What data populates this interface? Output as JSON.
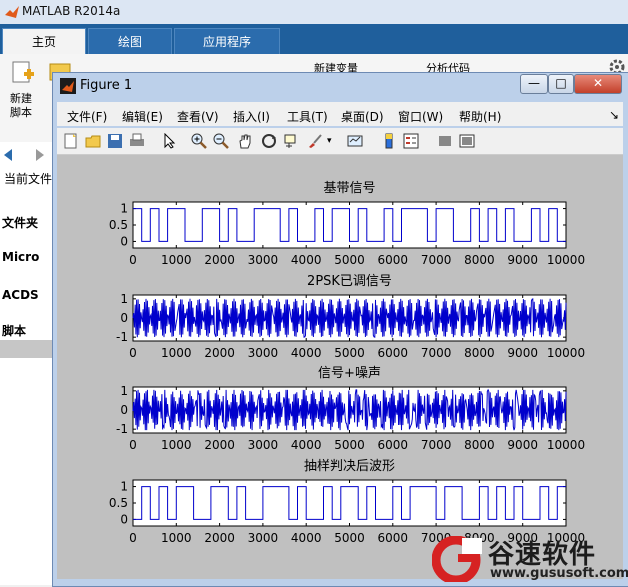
{
  "matlab": {
    "title": "MATLAB R2014a",
    "tabs": [
      "主页",
      "绘图",
      "应用程序"
    ],
    "ribbon": {
      "new_script_line1": "新建",
      "new_script_line2": "脚本",
      "new_variable": "新建变量",
      "analyze_code": "分析代码"
    },
    "left_panel": {
      "current_folder": "当前文件",
      "folder_header": "文件夹",
      "item1": "Micro",
      "item2": "ACDS",
      "item3": "脚本"
    }
  },
  "figure": {
    "title": "Figure 1",
    "buttons": [
      "—",
      "□",
      "✕"
    ],
    "menus": [
      "文件(F)",
      "编辑(E)",
      "查看(V)",
      "插入(I)",
      "工具(T)",
      "桌面(D)",
      "窗口(W)",
      "帮助(H)"
    ],
    "toolbar_icons": [
      "new-figure-icon",
      "open-icon",
      "save-icon",
      "print-icon",
      "pointer-icon",
      "zoom-in-icon",
      "zoom-out-icon",
      "pan-icon",
      "rotate-icon",
      "data-cursor-icon",
      "brush-icon",
      "link-icon",
      "colorbar-icon",
      "legend-icon",
      "hide-tools-icon",
      "dock-icon"
    ]
  },
  "chart_data": [
    {
      "type": "line",
      "title": "基带信号",
      "xlim": [
        0,
        10000
      ],
      "ylim": [
        -0.2,
        1.2
      ],
      "xticks": [
        "0",
        "1000",
        "2000",
        "3000",
        "4000",
        "5000",
        "6000",
        "7000",
        "8000",
        "9000",
        "10000"
      ],
      "yticks": [
        "1",
        "0.5",
        "0"
      ],
      "bits": [
        1,
        0,
        1,
        0,
        1,
        1,
        0,
        0,
        1,
        1,
        0,
        1,
        0,
        0,
        1,
        1,
        1,
        0,
        1,
        0,
        0,
        1,
        0,
        1,
        1,
        0,
        1,
        0,
        0,
        1,
        0,
        1,
        1,
        1,
        0,
        1,
        1,
        0,
        0,
        1,
        0,
        1,
        0,
        1,
        0,
        0,
        1,
        0,
        1,
        0
      ],
      "color": "#0000cc"
    },
    {
      "type": "line",
      "title": "2PSK已调信号",
      "xlim": [
        0,
        10000
      ],
      "ylim": [
        -1.2,
        1.2
      ],
      "xticks": [
        "0",
        "1000",
        "2000",
        "3000",
        "4000",
        "5000",
        "6000",
        "7000",
        "8000",
        "9000",
        "10000"
      ],
      "yticks": [
        "1",
        "0",
        "-1"
      ],
      "color": "#0000cc"
    },
    {
      "type": "line",
      "title": "信号+噪声",
      "xlim": [
        0,
        10000
      ],
      "ylim": [
        -1.2,
        1.2
      ],
      "xticks": [
        "0",
        "1000",
        "2000",
        "3000",
        "4000",
        "5000",
        "6000",
        "7000",
        "8000",
        "9000",
        "10000"
      ],
      "yticks": [
        "1",
        "0",
        "-1"
      ],
      "color": "#0000cc"
    },
    {
      "type": "line",
      "title": "抽样判决后波形",
      "xlim": [
        0,
        10000
      ],
      "ylim": [
        -0.2,
        1.2
      ],
      "xticks": [
        "0",
        "1000",
        "2000",
        "3000",
        "4000",
        "5000",
        "6000",
        "7000",
        "8000",
        "9000",
        "10000"
      ],
      "yticks": [
        "1",
        "0.5",
        "0"
      ],
      "bits": [
        0,
        1,
        0,
        1,
        0,
        1,
        1,
        0,
        0,
        1,
        1,
        0,
        1,
        0,
        0,
        1,
        1,
        1,
        0,
        1,
        0,
        0,
        1,
        0,
        1,
        1,
        0,
        1,
        0,
        0,
        1,
        0,
        1,
        1,
        1,
        0,
        1,
        1,
        0,
        0,
        1,
        0,
        1,
        0,
        1,
        0,
        0,
        1,
        0,
        1
      ],
      "color": "#0000cc"
    }
  ],
  "watermark": {
    "cn": "谷速软件",
    "url": "www.gususoft.com"
  }
}
